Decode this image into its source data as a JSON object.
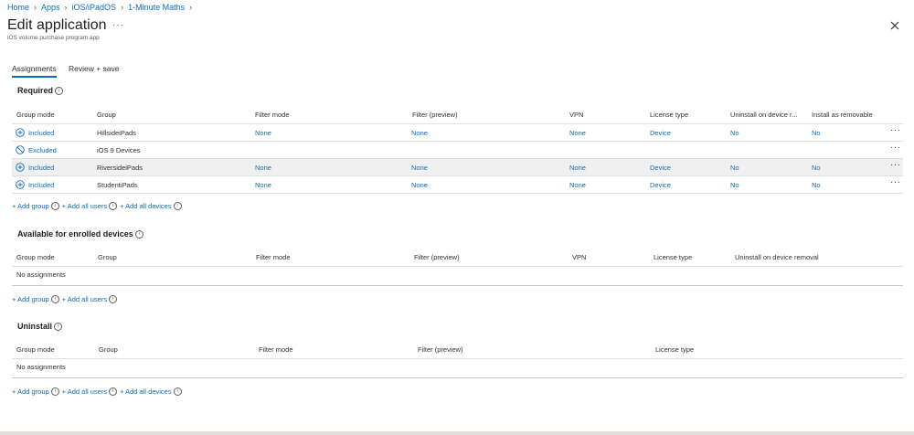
{
  "breadcrumb": [
    "Home",
    "Apps",
    "iOS/iPadOS",
    "1-Minute Maths"
  ],
  "title": "Edit application",
  "subtitle": "iOS volume purchase program app",
  "more": "···",
  "tabs": [
    "Assignments",
    "Review + save"
  ],
  "required": {
    "heading": "Required",
    "headers": [
      "Group mode",
      "Group",
      "Filter mode",
      "Filter (preview)",
      "VPN",
      "License type",
      "Uninstall on device r...",
      "Install as removable"
    ],
    "rows": [
      {
        "mode": "Included",
        "group": "HillsideiPads",
        "filter_mode": "None",
        "filter": "None",
        "vpn": "None",
        "license": "Device",
        "uninstall": "No",
        "removable": "No"
      },
      {
        "mode": "Excluded",
        "group": "iOS 9 Devices"
      },
      {
        "mode": "Included",
        "group": "RiversideiPads",
        "filter_mode": "None",
        "filter": "None",
        "vpn": "None",
        "license": "Device",
        "uninstall": "No",
        "removable": "No"
      },
      {
        "mode": "Included",
        "group": "StudentiPads",
        "filter_mode": "None",
        "filter": "None",
        "vpn": "None",
        "license": "Device",
        "uninstall": "No",
        "removable": "No"
      }
    ],
    "links": [
      "+ Add group",
      "+ Add all users",
      "+ Add all devices"
    ]
  },
  "available": {
    "heading": "Available for enrolled devices",
    "headers": [
      "Group mode",
      "Group",
      "Filter mode",
      "Filter (preview)",
      "VPN",
      "License type",
      "Uninstall on device removal"
    ],
    "empty": "No assignments",
    "links": [
      "+ Add group",
      "+ Add all users"
    ]
  },
  "uninstall": {
    "heading": "Uninstall",
    "headers": [
      "Group mode",
      "Group",
      "Filter mode",
      "Filter (preview)",
      "License type"
    ],
    "empty": "No assignments",
    "links": [
      "+ Add group",
      "+ Add all users",
      "+ Add all devices"
    ]
  },
  "colors": {
    "accent": "#0f6cbd",
    "row_highlight": "#f0f0f0"
  }
}
